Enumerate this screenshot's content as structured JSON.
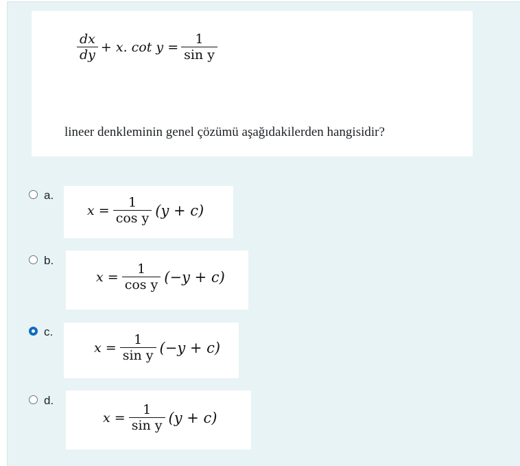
{
  "question": {
    "equation": {
      "lhs_num": "dx",
      "lhs_den": "dy",
      "middle": "+ x. cot y =",
      "rhs_num": "1",
      "rhs_den": "sin y"
    },
    "prompt": "lineer denkleminin genel çözümü aşağıdakilerden hangisidir?"
  },
  "options": [
    {
      "letter": "a.",
      "lhs": "x =",
      "num": "1",
      "den": "cos y",
      "tail": "(y + c)",
      "selected": false
    },
    {
      "letter": "b.",
      "lhs": "x =",
      "num": "1",
      "den": "cos y",
      "tail": "(−y + c)",
      "selected": false
    },
    {
      "letter": "c.",
      "lhs": "x =",
      "num": "1",
      "den": "sin y",
      "tail": "(−y + c)",
      "selected": true
    },
    {
      "letter": "d.",
      "lhs": "x =",
      "num": "1",
      "den": "sin y",
      "tail": "(y + c)",
      "selected": false
    }
  ],
  "colors": {
    "panel": "#e7f3f5",
    "accent": "#0f6cbf"
  }
}
